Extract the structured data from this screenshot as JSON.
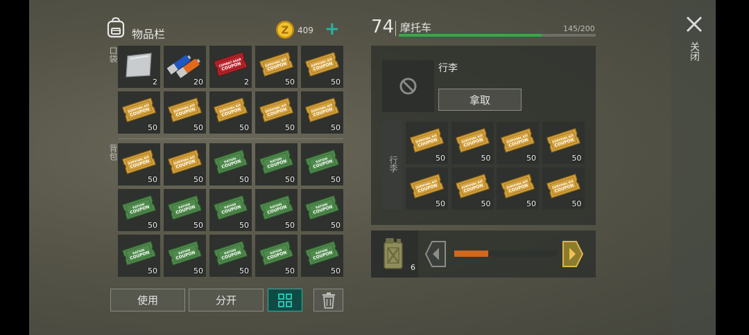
{
  "inventory": {
    "title": "物品栏",
    "coins": "409",
    "add_symbol": "+",
    "pocket_label": "口袋",
    "backpack_label": "背包",
    "pocket": [
      {
        "item": "metal-sheet-icon",
        "qty": "2"
      },
      {
        "item": "batteries-icon",
        "qty": "20"
      },
      {
        "item": "combat-coupon-icon",
        "qty": "2"
      },
      {
        "item": "survival-coupon-icon",
        "qty": "50"
      },
      {
        "item": "survival-coupon-icon",
        "qty": "50"
      },
      {
        "item": "survival-coupon-icon",
        "qty": "50"
      },
      {
        "item": "survival-coupon-icon",
        "qty": "50"
      },
      {
        "item": "survival-coupon-icon",
        "qty": "50"
      },
      {
        "item": "survival-coupon-icon",
        "qty": "50"
      },
      {
        "item": "survival-coupon-icon",
        "qty": "50"
      }
    ],
    "backpack": [
      {
        "item": "survival-coupon-icon",
        "qty": "50"
      },
      {
        "item": "survival-coupon-icon",
        "qty": "50"
      },
      {
        "item": "ration-coupon-icon",
        "qty": "50"
      },
      {
        "item": "ration-coupon-icon",
        "qty": "50"
      },
      {
        "item": "ration-coupon-icon",
        "qty": "50"
      },
      {
        "item": "ration-coupon-icon",
        "qty": "50"
      },
      {
        "item": "ration-coupon-icon",
        "qty": "50"
      },
      {
        "item": "ration-coupon-icon",
        "qty": "50"
      },
      {
        "item": "ration-coupon-icon",
        "qty": "50"
      },
      {
        "item": "ration-coupon-icon",
        "qty": "50"
      },
      {
        "item": "ration-coupon-icon",
        "qty": "50"
      },
      {
        "item": "ration-coupon-icon",
        "qty": "50"
      },
      {
        "item": "ration-coupon-icon",
        "qty": "50"
      },
      {
        "item": "ration-coupon-icon",
        "qty": "50"
      },
      {
        "item": "ration-coupon-icon",
        "qty": "50"
      }
    ],
    "buttons": {
      "use": "使用",
      "split": "分开"
    }
  },
  "motorcycle": {
    "level": "74",
    "name": "摩托车",
    "capacity": "145/200",
    "capacity_fraction": 0.725,
    "loot_title": "行李",
    "take_label": "拿取",
    "side_label": "行李",
    "items": [
      {
        "item": "survival-coupon-icon",
        "qty": "50"
      },
      {
        "item": "survival-coupon-icon",
        "qty": "50"
      },
      {
        "item": "survival-coupon-icon",
        "qty": "50"
      },
      {
        "item": "survival-coupon-icon",
        "qty": "50"
      },
      {
        "item": "survival-coupon-icon",
        "qty": "50"
      },
      {
        "item": "survival-coupon-icon",
        "qty": "50"
      },
      {
        "item": "survival-coupon-icon",
        "qty": "50"
      },
      {
        "item": "survival-coupon-icon",
        "qty": "50"
      }
    ],
    "fuel": {
      "qty": "6",
      "level": 0.33
    }
  },
  "close_label": "关闭",
  "colors": {
    "accent": "#27b3a3",
    "capacity_bar": "#3fa548",
    "fuel_bar": "#d1681d",
    "survival_coupon": "#d3a03c",
    "ration_coupon": "#4f8a4c",
    "combat_coupon": "#b8242b"
  }
}
